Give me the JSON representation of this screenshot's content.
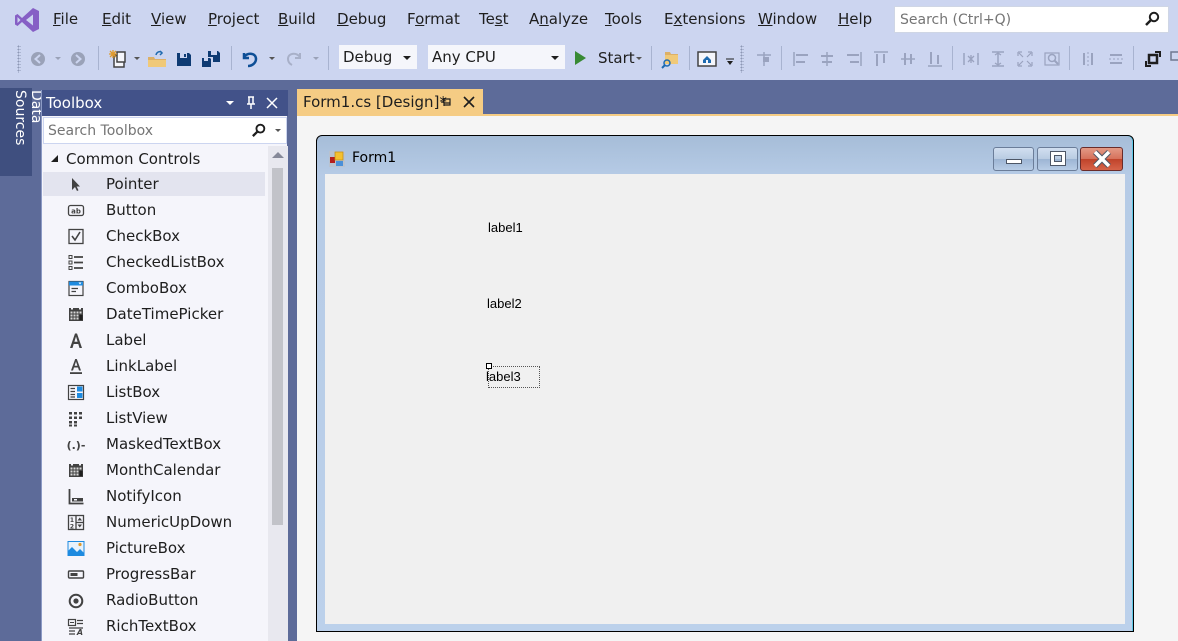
{
  "menubar": {
    "logo": "visual-studio-logo",
    "items": [
      {
        "label": "File",
        "accel": "F"
      },
      {
        "label": "Edit",
        "accel": "E"
      },
      {
        "label": "View",
        "accel": "V"
      },
      {
        "label": "Project",
        "accel": "P"
      },
      {
        "label": "Build",
        "accel": "B"
      },
      {
        "label": "Debug",
        "accel": "D"
      },
      {
        "label": "Format",
        "accel": "o"
      },
      {
        "label": "Test",
        "accel": "s"
      },
      {
        "label": "Analyze",
        "accel": "n"
      },
      {
        "label": "Tools",
        "accel": "T"
      },
      {
        "label": "Extensions",
        "accel": "x"
      },
      {
        "label": "Window",
        "accel": "W"
      },
      {
        "label": "Help",
        "accel": "H"
      }
    ],
    "search_placeholder": "Search (Ctrl+Q)"
  },
  "toolbar": {
    "configuration": "Debug",
    "platform": "Any CPU",
    "start_label": "Start",
    "icons": [
      "back-icon",
      "forward-icon",
      "new-item-icon",
      "open-folder-icon",
      "save-icon",
      "save-all-icon",
      "undo-icon",
      "redo-icon",
      "start-icon",
      "solution-explorer-icon",
      "home-window-icon",
      "align-lefts-icon",
      "align-centers-icon",
      "align-rights-icon",
      "align-tops-icon",
      "align-middles-icon",
      "align-bottoms-icon",
      "make-same-width-icon",
      "make-same-height-icon",
      "size-to-grid-icon",
      "zoom-icon",
      "horizontal-spacing-icon",
      "vertical-spacing-icon",
      "bring-to-front-icon"
    ]
  },
  "side_tabs": {
    "data_sources": "Data Sources"
  },
  "toolbox": {
    "title": "Toolbox",
    "search_placeholder": "Search Toolbox",
    "group": "Common Controls",
    "items": [
      {
        "label": "Pointer",
        "icon": "pointer-icon",
        "selected": true
      },
      {
        "label": "Button",
        "icon": "button-icon"
      },
      {
        "label": "CheckBox",
        "icon": "checkbox-icon"
      },
      {
        "label": "CheckedListBox",
        "icon": "checked-list-box-icon"
      },
      {
        "label": "ComboBox",
        "icon": "combobox-icon"
      },
      {
        "label": "DateTimePicker",
        "icon": "date-time-picker-icon"
      },
      {
        "label": "Label",
        "icon": "label-icon"
      },
      {
        "label": "LinkLabel",
        "icon": "link-label-icon"
      },
      {
        "label": "ListBox",
        "icon": "listbox-icon"
      },
      {
        "label": "ListView",
        "icon": "listview-icon"
      },
      {
        "label": "MaskedTextBox",
        "icon": "masked-textbox-icon"
      },
      {
        "label": "MonthCalendar",
        "icon": "month-calendar-icon"
      },
      {
        "label": "NotifyIcon",
        "icon": "notify-icon-icon"
      },
      {
        "label": "NumericUpDown",
        "icon": "numeric-up-down-icon"
      },
      {
        "label": "PictureBox",
        "icon": "picture-box-icon"
      },
      {
        "label": "ProgressBar",
        "icon": "progress-bar-icon"
      },
      {
        "label": "RadioButton",
        "icon": "radio-button-icon"
      },
      {
        "label": "RichTextBox",
        "icon": "rich-textbox-icon"
      }
    ]
  },
  "document": {
    "tab_title": "Form1.cs [Design]*",
    "form": {
      "title": "Form1",
      "labels": [
        "label1",
        "label2",
        "label3"
      ],
      "selected_label": "label3"
    }
  }
}
